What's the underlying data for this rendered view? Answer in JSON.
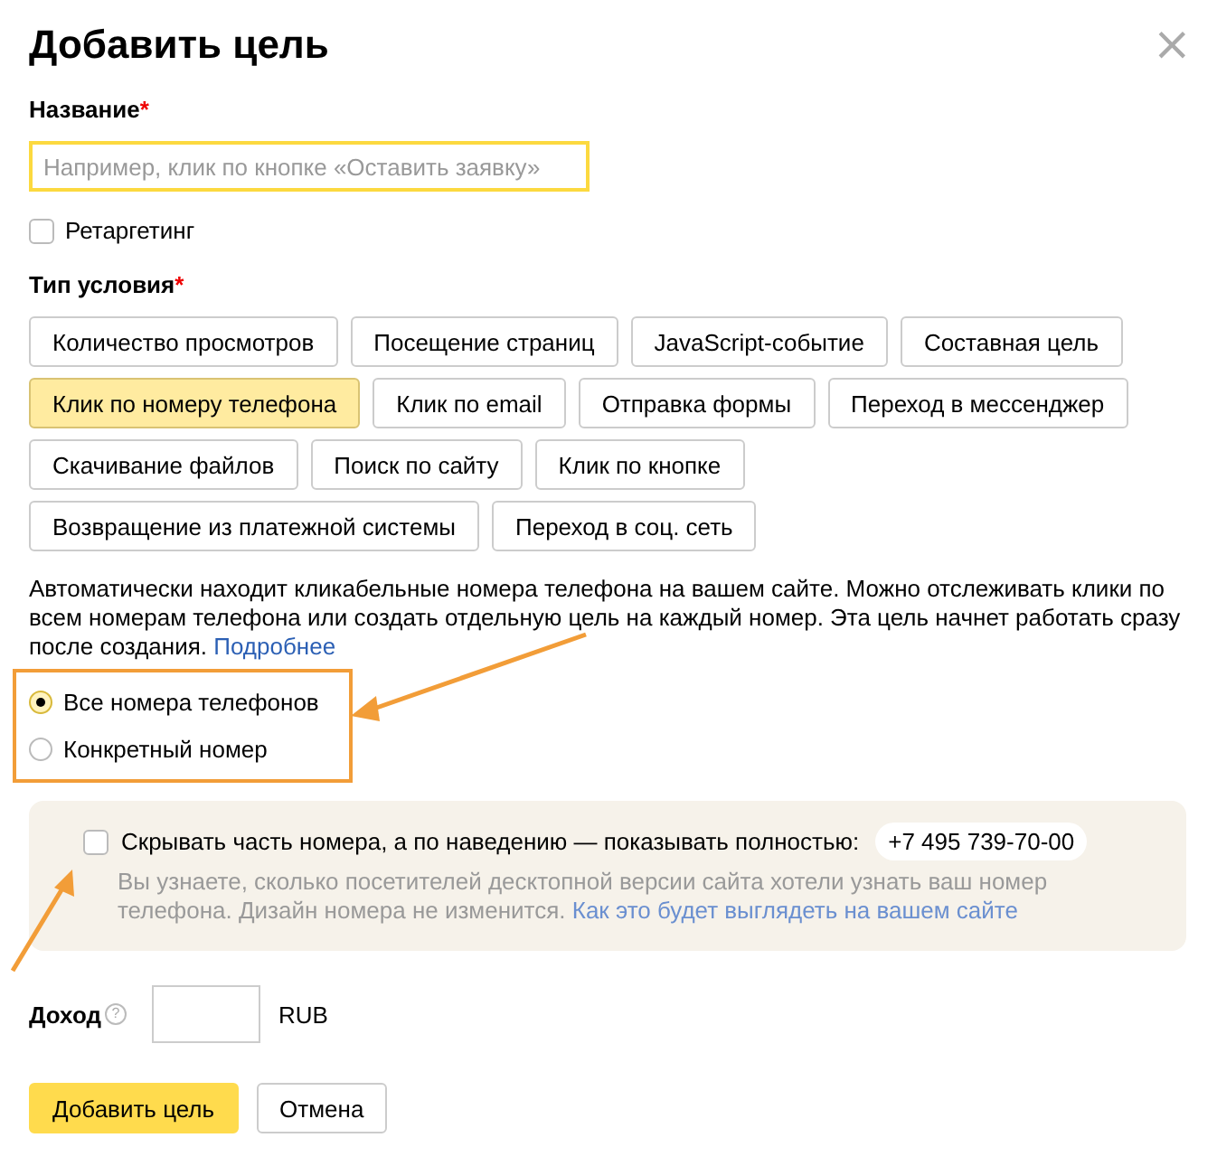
{
  "title": "Добавить цель",
  "close_icon": "×",
  "name_field": {
    "label": "Название",
    "required_mark": "*",
    "placeholder": "Например, клик по кнопке «Оставить заявку»",
    "focused": true
  },
  "retargeting": {
    "label": "Ретаргетинг",
    "checked": false
  },
  "condition_type": {
    "label": "Тип условия",
    "required_mark": "*",
    "rows": [
      {
        "items": [
          {
            "label": "Количество просмотров",
            "selected": false
          },
          {
            "label": "Посещение страниц",
            "selected": false
          },
          {
            "label": "JavaScript-событие",
            "selected": false
          },
          {
            "label": "Составная цель",
            "selected": false
          }
        ]
      },
      {
        "items": [
          {
            "label": "Клик по номеру телефона",
            "selected": true
          },
          {
            "label": "Клик по email",
            "selected": false
          },
          {
            "label": "Отправка формы",
            "selected": false
          },
          {
            "label": "Переход в мессенджер",
            "selected": false
          }
        ]
      },
      {
        "items": [
          {
            "label": "Скачивание файлов",
            "selected": false
          },
          {
            "label": "Поиск по сайту",
            "selected": false
          },
          {
            "label": "Клик по кнопке",
            "selected": false
          }
        ]
      },
      {
        "items": [
          {
            "label": "Возвращение из платежной системы",
            "selected": false
          },
          {
            "label": "Переход в соц. сеть",
            "selected": false
          }
        ]
      }
    ]
  },
  "description": {
    "text": "Автоматически находит кликабельные номера телефона на вашем сайте. Можно отслеживать клики по всем номерам телефона или создать отдельную цель на каждый номер. Эта цель начнет работать сразу после создания.",
    "link": "Подробнее"
  },
  "phone_options": [
    {
      "label": "Все номера телефонов",
      "selected": true
    },
    {
      "label": "Конкретный номер",
      "selected": false
    }
  ],
  "hide_number": {
    "label": "Скрывать часть номера, а по наведению — показывать полностью:",
    "phone": "+7 495 739-70-00",
    "checked": false,
    "hint": "Вы узнаете, сколько посетителей десктопной версии сайта хотели узнать ваш номер телефона. Дизайн номера не изменится.",
    "link": "Как это будет выглядеть на вашем сайте"
  },
  "income": {
    "label": "Доход",
    "help": "?",
    "currency": "RUB"
  },
  "buttons": [
    {
      "label": "Добавить цель",
      "kind": "primary"
    },
    {
      "label": "Отмена",
      "kind": "secondary"
    }
  ]
}
